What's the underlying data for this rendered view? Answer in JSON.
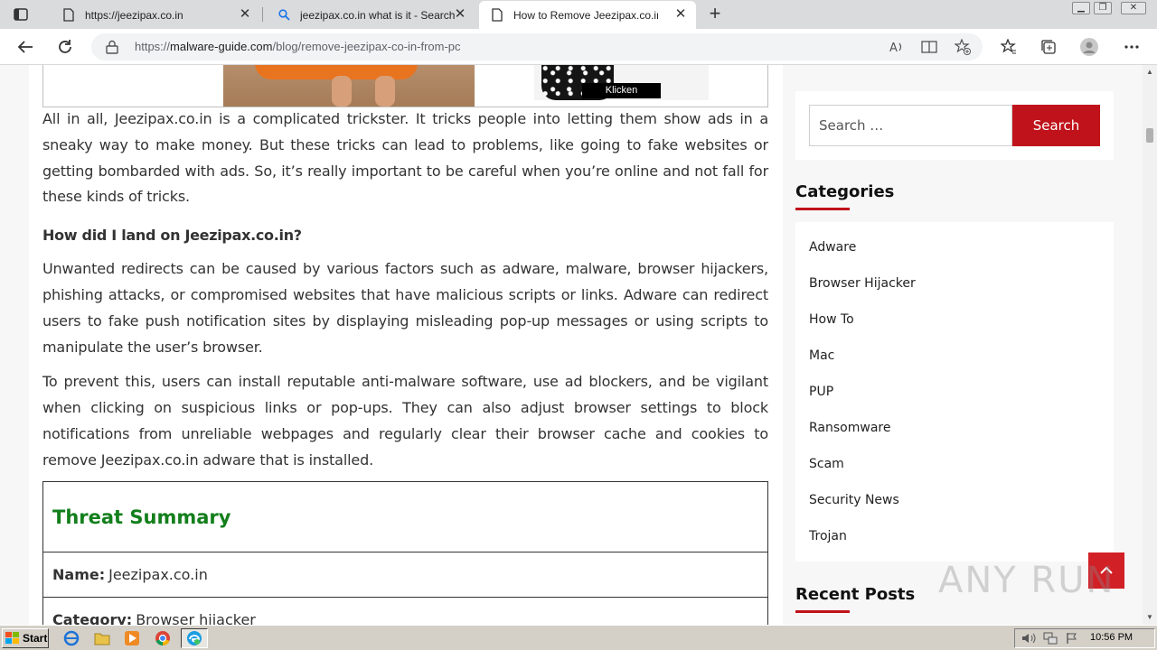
{
  "browser": {
    "tabs": [
      {
        "title": "https://jeezipax.co.in",
        "icon": "page-icon",
        "active": false
      },
      {
        "title": "jeezipax.co.in what is it - Search",
        "icon": "search-icon",
        "active": false
      },
      {
        "title": "How to Remove Jeezipax.co.in f",
        "icon": "page-icon",
        "active": true
      }
    ],
    "url": {
      "scheme": "https://",
      "host": "malware-guide.com",
      "path": "/blog/remove-jeezipax-co-in-from-pc"
    }
  },
  "ad": {
    "button_label": "Klicken"
  },
  "article": {
    "paragraph_1": "All in all, Jeezipax.co.in is a complicated trickster. It tricks people into letting them show ads in a sneaky way to make money. But these tricks can lead to problems, like going to fake websites or getting bombarded with ads. So, it’s really important to be careful when you’re online and not fall for these kinds of tricks.",
    "heading": "How did I land on Jeezipax.co.in?",
    "paragraph_2": "Unwanted redirects can be caused by various factors such as adware, malware, browser hijackers, phishing attacks, or compromised websites that have malicious scripts or links. Adware can redirect users to fake push notification sites by displaying misleading pop-up messages or using scripts to manipulate the user’s browser.",
    "paragraph_3": "To prevent this, users can install reputable anti-malware software, use ad blockers, and be vigilant when clicking on suspicious links or pop-ups. They can also adjust browser settings to block notifications from unreliable webpages and regularly clear their browser cache and cookies to remove Jeezipax.co.in adware that is installed.",
    "threat_summary": {
      "title": "Threat Summary",
      "name_label": "Name:",
      "name_value": "Jeezipax.co.in",
      "category_label": "Category:",
      "category_value": "Browser hijacker"
    }
  },
  "sidebar": {
    "search": {
      "placeholder": "Search …",
      "button_label": "Search"
    },
    "categories_title": "Categories",
    "categories": [
      "Adware",
      "Browser Hijacker",
      "How To",
      "Mac",
      "PUP",
      "Ransomware",
      "Scam",
      "Security News",
      "Trojan"
    ],
    "recent_posts_title": "Recent Posts"
  },
  "watermark": "ANY RUN",
  "taskbar": {
    "start_label": "Start",
    "clock": "10:56 PM"
  },
  "colors": {
    "accent_red": "#c0121a",
    "threat_green": "#137f1c"
  }
}
